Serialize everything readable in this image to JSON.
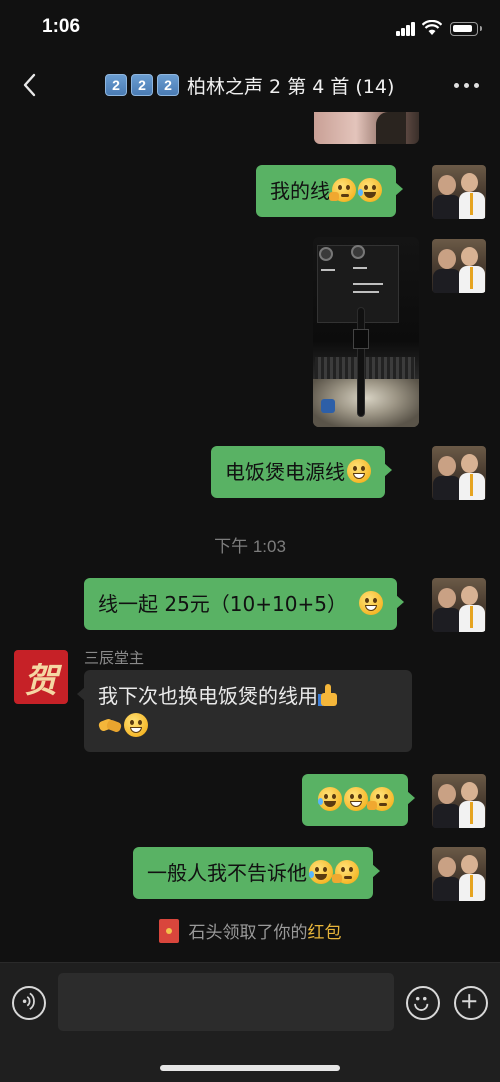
{
  "status_bar": {
    "time": "1:06"
  },
  "header": {
    "badges": [
      "2",
      "2",
      "2"
    ],
    "title": "柏林之声 2 第 4 首 (14)"
  },
  "messages": {
    "m1": {
      "text": "我的线"
    },
    "m3": {
      "text": "电饭煲电源线"
    },
    "time_sep": "下午 1:03",
    "m4": {
      "text": "线一起 25元（10+10+5）"
    },
    "m5": {
      "sender": "三辰堂主",
      "line1": "我下次也换电饭煲的线用",
      "avatar_glyph": "贺"
    },
    "m7": {
      "text": "一般人我不告诉他"
    }
  },
  "system_message": {
    "prefix": "石头领取了你的",
    "link": "红包"
  },
  "input_bar": {
    "placeholder": ""
  },
  "colors": {
    "outgoing_bubble": "#59b264",
    "incoming_bubble": "#2b2b2b",
    "background": "#111111",
    "link": "#e7b53a"
  },
  "icons": [
    "back-icon",
    "more-icon",
    "voice-icon",
    "emoji-icon",
    "plus-icon",
    "red-packet-icon"
  ]
}
